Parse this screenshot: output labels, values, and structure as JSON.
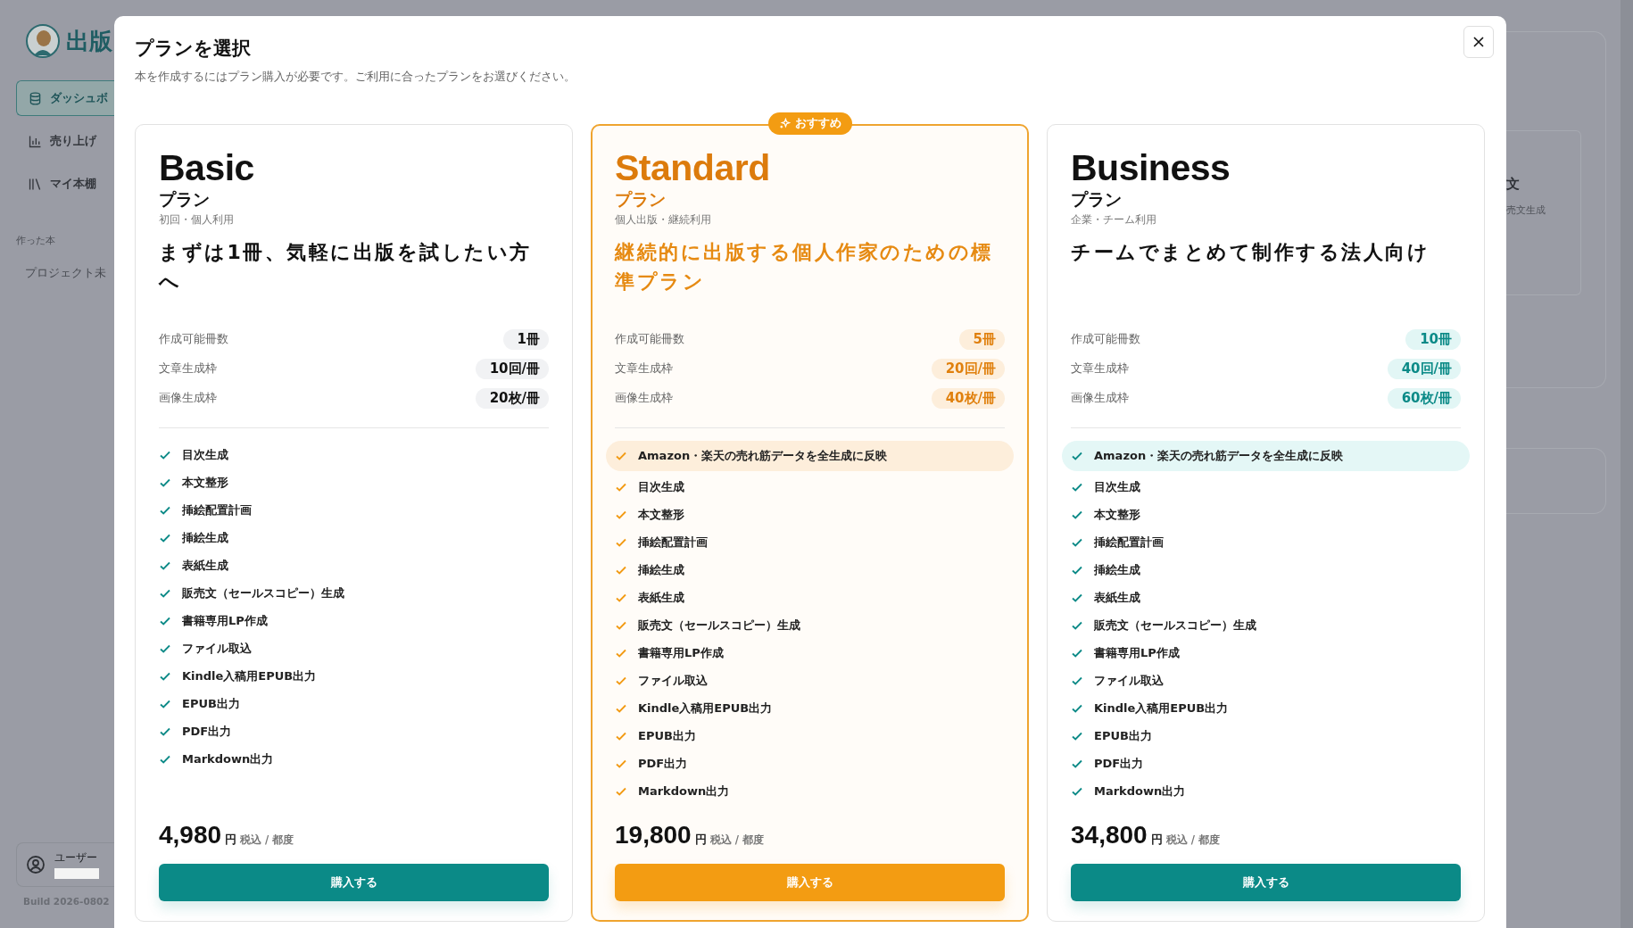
{
  "sidebar": {
    "logo_text": "出版",
    "nav": [
      {
        "label": "ダッシュボ",
        "kind": "database",
        "selected": true
      },
      {
        "label": "売り上げ",
        "kind": "chart",
        "selected": false
      },
      {
        "label": "マイ本棚",
        "kind": "books",
        "selected": false
      }
    ],
    "section_title": "作った本",
    "projects": [
      "プロジェクト未"
    ],
    "user_label": "ユーザー",
    "build": "Build 2026-0802"
  },
  "background_card": {
    "title": "文",
    "subtitle": "売文生成"
  },
  "modal": {
    "title": "プランを選択",
    "subtitle": "本を作成するにはプラン購入が必要です。ご利用に合ったプランをお選びください。",
    "plans": [
      {
        "kind": "basic",
        "name": "Basic",
        "suffix": "プラン",
        "audience": "初回・個人利用",
        "tagline": "まずは1冊、気軽に出版を試したい方へ",
        "specs": [
          {
            "label": "作成可能冊数",
            "value": "1冊"
          },
          {
            "label": "文章生成枠",
            "value": "10回/冊"
          },
          {
            "label": "画像生成枠",
            "value": "20枚/冊"
          }
        ],
        "features": [
          {
            "text": "目次生成",
            "highlighted": false
          },
          {
            "text": "本文整形",
            "highlighted": false
          },
          {
            "text": "挿絵配置計画",
            "highlighted": false
          },
          {
            "text": "挿絵生成",
            "highlighted": false
          },
          {
            "text": "表紙生成",
            "highlighted": false
          },
          {
            "text": "販売文（セールスコピー）生成",
            "highlighted": false
          },
          {
            "text": "書籍専用LP作成",
            "highlighted": false
          },
          {
            "text": "ファイル取込",
            "highlighted": false
          },
          {
            "text": "Kindle入稿用EPUB出力",
            "highlighted": false
          },
          {
            "text": "EPUB出力",
            "highlighted": false
          },
          {
            "text": "PDF出力",
            "highlighted": false
          },
          {
            "text": "Markdown出力",
            "highlighted": false
          }
        ],
        "price": "4,980",
        "currency": "円",
        "price_note": "税込 / 都度",
        "button": "購入する"
      },
      {
        "kind": "standard",
        "badge": "おすすめ",
        "name": "Standard",
        "suffix": "プラン",
        "audience": "個人出版・継続利用",
        "tagline": "継続的に出版する個人作家のための標準プラン",
        "specs": [
          {
            "label": "作成可能冊数",
            "value": "5冊"
          },
          {
            "label": "文章生成枠",
            "value": "20回/冊"
          },
          {
            "label": "画像生成枠",
            "value": "40枚/冊"
          }
        ],
        "features": [
          {
            "text": "Amazon・楽天の売れ筋データを全生成に反映",
            "highlighted": true
          },
          {
            "text": "目次生成",
            "highlighted": false
          },
          {
            "text": "本文整形",
            "highlighted": false
          },
          {
            "text": "挿絵配置計画",
            "highlighted": false
          },
          {
            "text": "挿絵生成",
            "highlighted": false
          },
          {
            "text": "表紙生成",
            "highlighted": false
          },
          {
            "text": "販売文（セールスコピー）生成",
            "highlighted": false
          },
          {
            "text": "書籍専用LP作成",
            "highlighted": false
          },
          {
            "text": "ファイル取込",
            "highlighted": false
          },
          {
            "text": "Kindle入稿用EPUB出力",
            "highlighted": false
          },
          {
            "text": "EPUB出力",
            "highlighted": false
          },
          {
            "text": "PDF出力",
            "highlighted": false
          },
          {
            "text": "Markdown出力",
            "highlighted": false
          }
        ],
        "price": "19,800",
        "currency": "円",
        "price_note": "税込 / 都度",
        "button": "購入する"
      },
      {
        "kind": "business",
        "name": "Business",
        "suffix": "プラン",
        "audience": "企業・チーム利用",
        "tagline": "チームでまとめて制作する法人向け",
        "specs": [
          {
            "label": "作成可能冊数",
            "value": "10冊"
          },
          {
            "label": "文章生成枠",
            "value": "40回/冊"
          },
          {
            "label": "画像生成枠",
            "value": "60枚/冊"
          }
        ],
        "features": [
          {
            "text": "Amazon・楽天の売れ筋データを全生成に反映",
            "highlighted": true
          },
          {
            "text": "目次生成",
            "highlighted": false
          },
          {
            "text": "本文整形",
            "highlighted": false
          },
          {
            "text": "挿絵配置計画",
            "highlighted": false
          },
          {
            "text": "挿絵生成",
            "highlighted": false
          },
          {
            "text": "表紙生成",
            "highlighted": false
          },
          {
            "text": "販売文（セールスコピー）生成",
            "highlighted": false
          },
          {
            "text": "書籍専用LP作成",
            "highlighted": false
          },
          {
            "text": "ファイル取込",
            "highlighted": false
          },
          {
            "text": "Kindle入稿用EPUB出力",
            "highlighted": false
          },
          {
            "text": "EPUB出力",
            "highlighted": false
          },
          {
            "text": "PDF出力",
            "highlighted": false
          },
          {
            "text": "Markdown出力",
            "highlighted": false
          }
        ],
        "price": "34,800",
        "currency": "円",
        "price_note": "税込 / 都度",
        "button": "購入する"
      }
    ]
  }
}
